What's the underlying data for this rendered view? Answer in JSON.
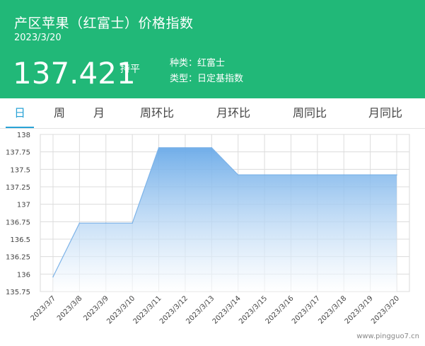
{
  "header": {
    "title": "产区苹果（红富士）价格指数",
    "date": "2023/3/20",
    "price": "137.421",
    "trend": "持平",
    "variety_line": "种类：红富士",
    "type_line": "类型：日定基指数",
    "bg_color": "#21b878"
  },
  "tabs": [
    "日",
    "周",
    "月",
    "周环比",
    "月环比",
    "周同比",
    "月同比"
  ],
  "active_tab": "日",
  "watermark": "www.pingguo7.cn",
  "chart_data": {
    "type": "area",
    "title": "",
    "xlabel": "",
    "ylabel": "",
    "x": [
      "2023/3/7",
      "2023/3/8",
      "2023/3/9",
      "2023/3/10",
      "2023/3/11",
      "2023/3/12",
      "2023/3/13",
      "2023/3/14",
      "2023/3/15",
      "2023/3/16",
      "2023/3/17",
      "2023/3/18",
      "2023/3/19",
      "2023/3/20"
    ],
    "series": [
      {
        "values": [
          135.96,
          136.73,
          136.73,
          136.73,
          137.81,
          137.81,
          137.81,
          137.421,
          137.421,
          137.421,
          137.421,
          137.421,
          137.421,
          137.421
        ]
      }
    ],
    "ylim": [
      135.75,
      138
    ],
    "yticks": [
      135.75,
      136,
      136.25,
      136.5,
      136.75,
      137,
      137.25,
      137.5,
      137.75,
      138
    ],
    "ytick_labels": [
      "135.75",
      "136",
      "136.25",
      "136.5",
      "136.75",
      "137",
      "137.25",
      "137.5",
      "137.75",
      "138"
    ],
    "grid": true,
    "line_color": "#7db3e8",
    "fill_top_color": "#6aaae8",
    "fill_bottom_color": "#ffffff"
  }
}
